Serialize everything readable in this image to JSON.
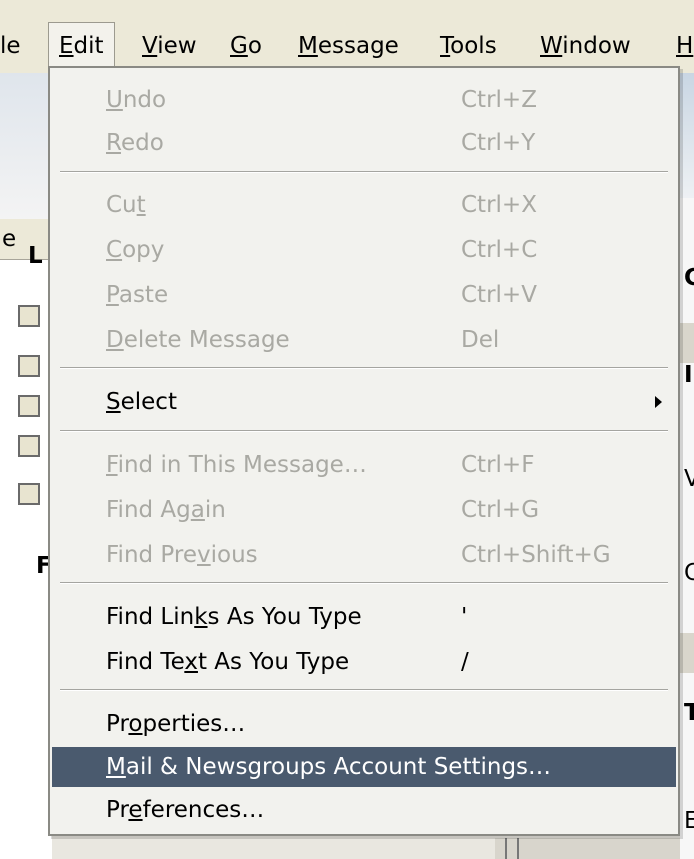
{
  "menubar": {
    "items": [
      {
        "pre": "",
        "ul": "",
        "post": "le"
      },
      {
        "pre": "",
        "ul": "E",
        "post": "dit"
      },
      {
        "pre": "",
        "ul": "V",
        "post": "iew"
      },
      {
        "pre": "",
        "ul": "G",
        "post": "o"
      },
      {
        "pre": "",
        "ul": "M",
        "post": "essage"
      },
      {
        "pre": "",
        "ul": "T",
        "post": "ools"
      },
      {
        "pre": "",
        "ul": "W",
        "post": "indow"
      },
      {
        "pre": "",
        "ul": "H",
        "post": ""
      }
    ]
  },
  "background": {
    "left_header": "e",
    "left_tree_top": "L",
    "left_tree_bottom": "F",
    "right_letters": [
      "C",
      "I",
      "V",
      "C",
      "T",
      "E"
    ]
  },
  "edit_menu": {
    "items": [
      {
        "pre": "",
        "ul": "U",
        "post": "ndo",
        "shortcut": "Ctrl+Z",
        "enabled": false
      },
      {
        "pre": "",
        "ul": "R",
        "post": "edo",
        "shortcut": "Ctrl+Y",
        "enabled": false
      },
      {
        "pre": "Cu",
        "ul": "t",
        "post": "",
        "shortcut": "Ctrl+X",
        "enabled": false
      },
      {
        "pre": "",
        "ul": "C",
        "post": "opy",
        "shortcut": "Ctrl+C",
        "enabled": false
      },
      {
        "pre": "",
        "ul": "P",
        "post": "aste",
        "shortcut": "Ctrl+V",
        "enabled": false
      },
      {
        "pre": "",
        "ul": "D",
        "post": "elete Message",
        "shortcut": "Del",
        "enabled": false
      },
      {
        "pre": "",
        "ul": "S",
        "post": "elect",
        "shortcut": "",
        "enabled": true,
        "submenu": true
      },
      {
        "pre": "",
        "ul": "F",
        "post": "ind in This Message…",
        "shortcut": "Ctrl+F",
        "enabled": false
      },
      {
        "pre": "Find Ag",
        "ul": "a",
        "post": "in",
        "shortcut": "Ctrl+G",
        "enabled": false
      },
      {
        "pre": "Find Pre",
        "ul": "v",
        "post": "ious",
        "shortcut": "Ctrl+Shift+G",
        "enabled": false
      },
      {
        "pre": "Find Lin",
        "ul": "k",
        "post": "s As You Type",
        "shortcut": "'",
        "enabled": true
      },
      {
        "pre": "Find Te",
        "ul": "x",
        "post": "t As You Type",
        "shortcut": "/",
        "enabled": true
      },
      {
        "pre": "Pr",
        "ul": "o",
        "post": "perties…",
        "shortcut": "",
        "enabled": true
      },
      {
        "pre": "",
        "ul": "M",
        "post": "ail & Newsgroups Account Settings…",
        "shortcut": "",
        "enabled": true,
        "highlighted": true
      },
      {
        "pre": "Pr",
        "ul": "e",
        "post": "ferences…",
        "shortcut": "",
        "enabled": true
      }
    ]
  },
  "colors": {
    "menu_bg": "#f2f2ee",
    "highlight": "#4a5a6e",
    "disabled_text": "#a9a9a3"
  }
}
